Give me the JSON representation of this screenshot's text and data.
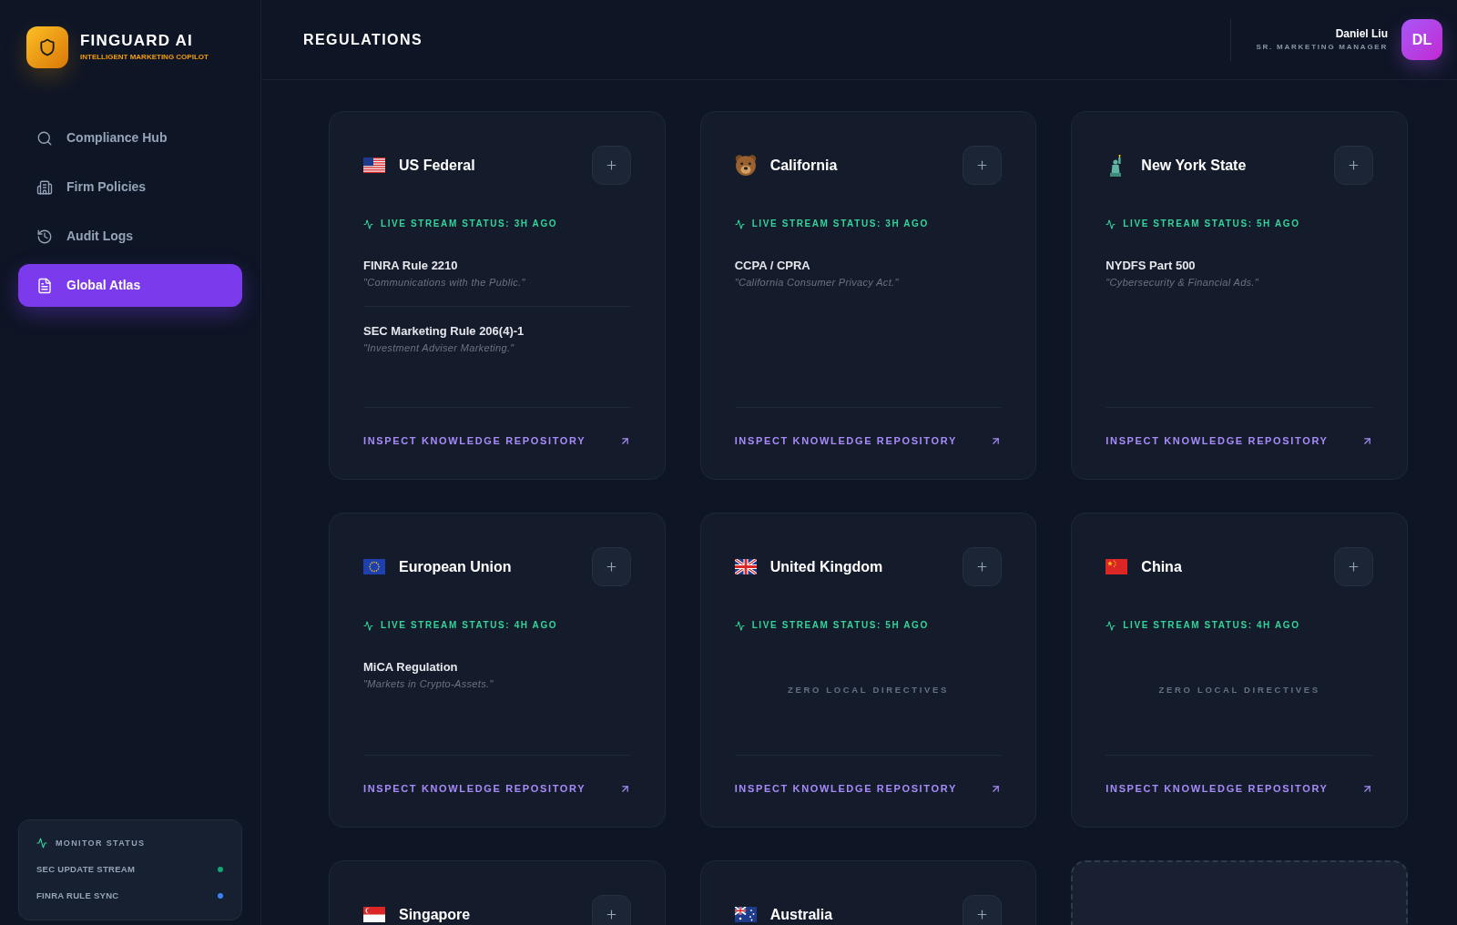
{
  "brand": {
    "name": "FINGUARD AI",
    "tagline": "INTELLIGENT MARKETING COPILOT"
  },
  "nav": [
    {
      "label": "Compliance Hub",
      "selected": false
    },
    {
      "label": "Firm Policies",
      "selected": false
    },
    {
      "label": "Audit Logs",
      "selected": false
    },
    {
      "label": "Global Atlas",
      "selected": true
    }
  ],
  "monitor": {
    "title": "MONITOR STATUS",
    "items": [
      {
        "label": "SEC UPDATE STREAM",
        "color": "#10a874"
      },
      {
        "label": "FINRA RULE SYNC",
        "color": "#3b82f6"
      }
    ]
  },
  "header": {
    "title": "REGULATIONS",
    "user": {
      "name": "Daniel Liu",
      "role": "SR. MARKETING MANAGER",
      "initials": "DL"
    }
  },
  "regions": [
    {
      "kind": "region",
      "name": "US Federal",
      "status": "LIVE STREAM STATUS: 3H AGO",
      "rules": [
        {
          "title": "FINRA Rule 2210",
          "description": "\"Communications with the Public.\""
        },
        {
          "title": "SEC Marketing Rule 206(4)-1",
          "description": "\"Investment Adviser Marketing.\""
        }
      ],
      "link": "INSPECT KNOWLEDGE REPOSITORY"
    },
    {
      "kind": "region",
      "name": "California",
      "status": "LIVE STREAM STATUS: 3H AGO",
      "rules": [
        {
          "title": "CCPA / CPRA",
          "description": "\"California Consumer Privacy Act.\""
        }
      ],
      "link": "INSPECT KNOWLEDGE REPOSITORY"
    },
    {
      "kind": "region",
      "name": "New York State",
      "status": "LIVE STREAM STATUS: 5H AGO",
      "rules": [
        {
          "title": "NYDFS Part 500",
          "description": "\"Cybersecurity & Financial Ads.\""
        }
      ],
      "link": "INSPECT KNOWLEDGE REPOSITORY"
    },
    {
      "kind": "region",
      "name": "European Union",
      "status": "LIVE STREAM STATUS: 4H AGO",
      "rules": [
        {
          "title": "MiCA Regulation",
          "description": "\"Markets in Crypto-Assets.\""
        }
      ],
      "link": "INSPECT KNOWLEDGE REPOSITORY"
    },
    {
      "kind": "region",
      "name": "United Kingdom",
      "status": "LIVE STREAM STATUS: 5H AGO",
      "empty_note": "ZERO LOCAL DIRECTIVES",
      "link": "INSPECT KNOWLEDGE REPOSITORY"
    },
    {
      "kind": "region",
      "name": "China",
      "status": "LIVE STREAM STATUS: 4H AGO",
      "empty_note": "ZERO LOCAL DIRECTIVES",
      "link": "INSPECT KNOWLEDGE REPOSITORY"
    },
    {
      "kind": "region",
      "name": "Singapore"
    },
    {
      "kind": "region",
      "name": "Australia"
    },
    {
      "kind": "placeholder"
    }
  ]
}
